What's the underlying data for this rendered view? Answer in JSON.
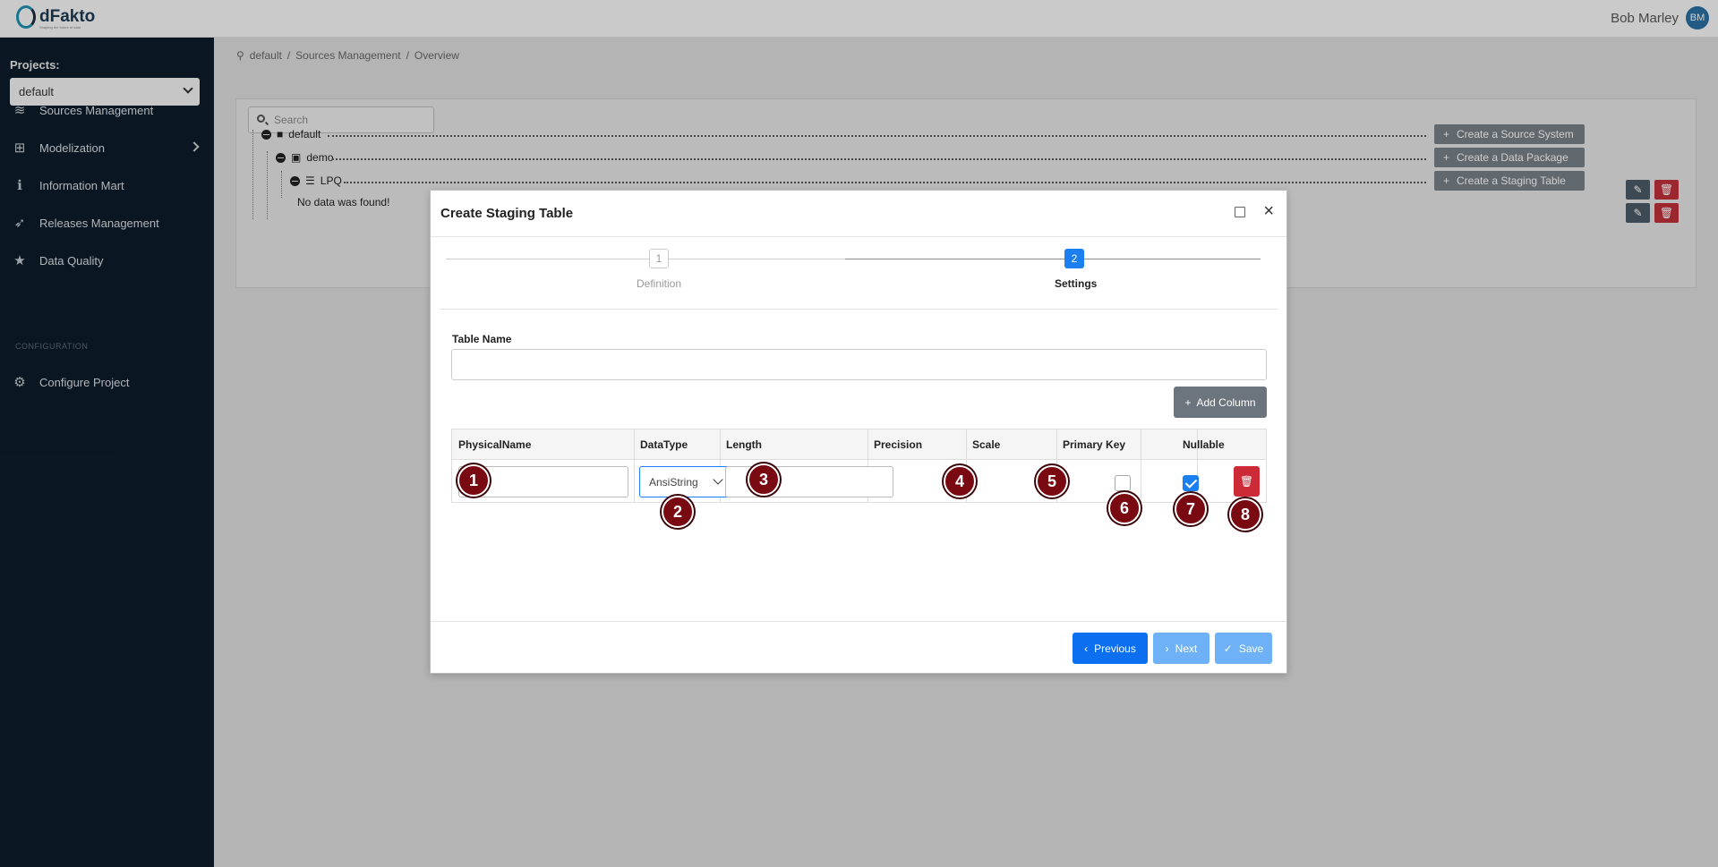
{
  "app": {
    "logo_text": "dFakto",
    "logo_subtitle": "Shaping the future of data"
  },
  "user": {
    "name": "Bob Marley",
    "initials": "BM"
  },
  "sidebar": {
    "projects_label": "Projects:",
    "project_selected": "default",
    "items": [
      {
        "label": "Sources Management",
        "icon": "layers-icon"
      },
      {
        "label": "Modelization",
        "icon": "hierarchy-icon"
      },
      {
        "label": "Information Mart",
        "icon": "info-icon"
      },
      {
        "label": "Releases Management",
        "icon": "rocket-icon"
      },
      {
        "label": "Data Quality",
        "icon": "star-icon"
      }
    ],
    "config_label": "CONFIGURATION",
    "config_items": [
      {
        "label": "Configure Project",
        "icon": "gear-icon"
      }
    ]
  },
  "breadcrumb": {
    "items": [
      "default",
      "Sources Management",
      "Overview"
    ]
  },
  "search": {
    "placeholder": "Search"
  },
  "tree": {
    "nodes": [
      "default",
      "demo",
      "LPQ"
    ],
    "empty_text": "No data was found!",
    "actions": [
      "Create a Source System",
      "Create a Data Package",
      "Create a Staging Table"
    ]
  },
  "modal": {
    "title": "Create Staging Table",
    "steps": [
      {
        "num": "1",
        "label": "Definition"
      },
      {
        "num": "2",
        "label": "Settings"
      }
    ],
    "table_name_label": "Table Name",
    "table_name_value": "",
    "add_column_label": "Add Column",
    "columns": [
      "PhysicalName",
      "DataType",
      "Length",
      "Precision",
      "Scale",
      "Primary Key",
      "Nullable"
    ],
    "row": {
      "physical_name": "",
      "data_type": "AnsiString",
      "length": "",
      "primary_key": false,
      "nullable": true
    },
    "buttons": {
      "previous": "Previous",
      "next": "Next",
      "save": "Save"
    }
  },
  "markers": [
    "1",
    "2",
    "3",
    "4",
    "5",
    "6",
    "7",
    "8"
  ]
}
